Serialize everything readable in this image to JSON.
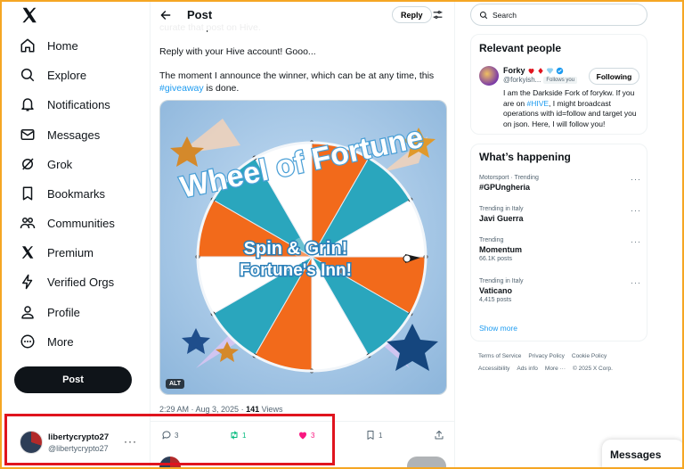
{
  "nav": {
    "items": [
      {
        "label": "Home",
        "icon": "home-icon"
      },
      {
        "label": "Explore",
        "icon": "search-icon"
      },
      {
        "label": "Notifications",
        "icon": "bell-icon"
      },
      {
        "label": "Messages",
        "icon": "envelope-icon"
      },
      {
        "label": "Grok",
        "icon": "grok-icon"
      },
      {
        "label": "Bookmarks",
        "icon": "bookmark-icon"
      },
      {
        "label": "Communities",
        "icon": "people-icon"
      },
      {
        "label": "Premium",
        "icon": "x-logo-icon"
      },
      {
        "label": "Verified Orgs",
        "icon": "lightning-icon"
      },
      {
        "label": "Profile",
        "icon": "person-icon"
      },
      {
        "label": "More",
        "icon": "more-circle-icon"
      }
    ],
    "post_label": "Post"
  },
  "account": {
    "name": "libertycrypto27",
    "handle": "@libertycrypto27",
    "more": "···"
  },
  "header": {
    "title": "Post",
    "reply_label": "Reply"
  },
  "post": {
    "line_cut": "curate that post on Hive.",
    "line2": "Reply with your Hive account! Gooo...",
    "line3_a": "The moment I announce the winner, which can be at any time, this",
    "hashtag": "#giveaway",
    "line3_b": " is done.",
    "image_text": {
      "title": "Wheel of Fortune",
      "line1": "Spin & Grin!",
      "line2": "Fortune's Inn!"
    },
    "alt_label": "ALT",
    "time": "2:29 AM · Aug 3, 2025 · ",
    "views_count": "141",
    "views_label": " Views"
  },
  "actions": {
    "replies": "3",
    "reposts": "1",
    "likes": "3",
    "bookmarks": "1"
  },
  "colors": {
    "accent": "#1d9bf0",
    "repost": "#00ba7c",
    "like": "#f91880",
    "highlight": "#e0141e",
    "wheel_orange": "#f26a1b",
    "wheel_teal": "#2aa6bd"
  },
  "search": {
    "placeholder": "Search"
  },
  "relevant": {
    "title": "Relevant people",
    "name": "Forky",
    "handle": "@forkyish...",
    "follows_you": "Follows you",
    "button": "Following",
    "bio_a": "I am the Darkside Fork of forykw. If you are on ",
    "bio_tag": "#HIVE",
    "bio_b": ", I might broadcast operations with id=follow and target you on json. Here, I will follow you!"
  },
  "happening": {
    "title": "What’s happening",
    "trends": [
      {
        "context": "Motorsport · Trending",
        "name": "#GPUngheria",
        "count": ""
      },
      {
        "context": "Trending in Italy",
        "name": "Javi Guerra",
        "count": ""
      },
      {
        "context": "Trending",
        "name": "Momentum",
        "count": "66.1K posts"
      },
      {
        "context": "Trending in Italy",
        "name": "Vaticano",
        "count": "4,415 posts"
      }
    ],
    "show_more": "Show more"
  },
  "footer": {
    "links": [
      "Terms of Service",
      "Privacy Policy",
      "Cookie Policy",
      "Accessibility",
      "Ads info",
      "More ···",
      "© 2025 X Corp."
    ]
  },
  "messages_bar": {
    "label": "Messages"
  }
}
